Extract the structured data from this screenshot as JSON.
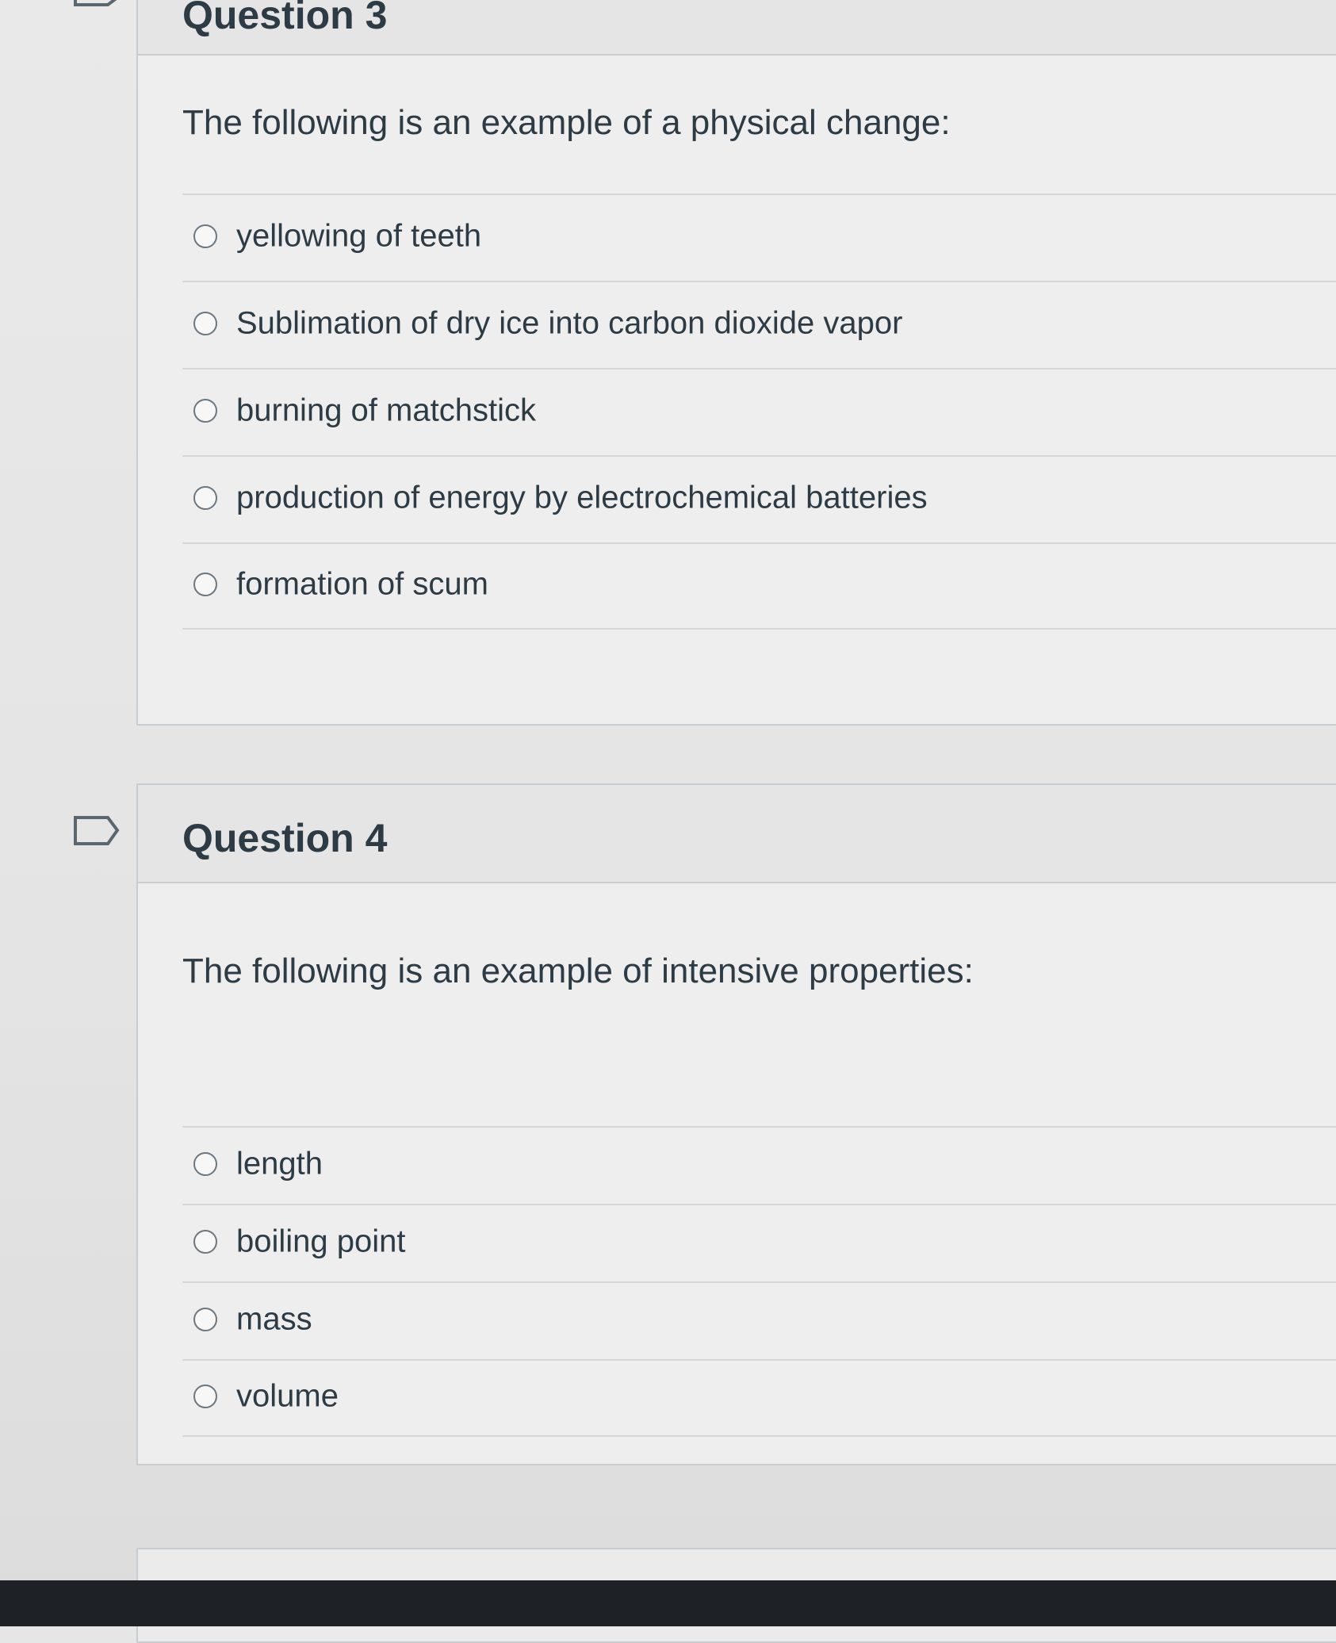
{
  "questions": [
    {
      "title": "Question 3",
      "prompt": "The following is an example of a physical change:",
      "answers": [
        "yellowing of teeth",
        "Sublimation of dry ice into carbon dioxide vapor",
        "burning of matchstick",
        "production of energy by electrochemical batteries",
        "formation of scum"
      ]
    },
    {
      "title": "Question 4",
      "prompt": "The following is an example of intensive properties:",
      "answers": [
        "length",
        "boiling point",
        "mass",
        "volume"
      ]
    }
  ],
  "icons": {
    "flag": "flag-icon",
    "radio": "radio-button"
  },
  "colors": {
    "text": "#2d3b45",
    "border": "#c7cdd1",
    "background": "#e6e6e6"
  }
}
